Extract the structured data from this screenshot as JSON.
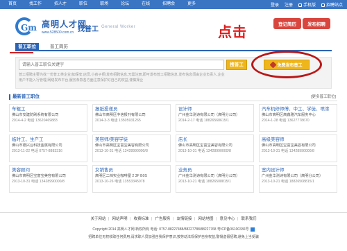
{
  "topnav": {
    "items": [
      "首页",
      "找工作",
      "招人才",
      "职位",
      "职场",
      "论坛",
      "在线",
      "招聘会",
      "更多"
    ],
    "login": "登录",
    "register": "注册",
    "mobile": "手机版",
    "site": "招聘站点"
  },
  "logo": {
    "name": "高明人才网",
    "url": "www.528500.com.cn"
  },
  "subbrand": {
    "cn": "找普工",
    "en": "General Worker"
  },
  "annotation": "点击",
  "buttons": {
    "login": "登记简历",
    "post": "发布招聘"
  },
  "tabs": [
    {
      "label": "普工职位"
    },
    {
      "label": "普工简历"
    }
  ],
  "search": {
    "placeholder": "请输入普工职位关键字",
    "button": "搜普工",
    "post_free": "免费发布普工",
    "tip": "普工招聘主要为找一份普工类企业(如保安,店员,小孩子师)发布招聘信息,无需注册,即可发布普工招聘信息 发布信息须由企业负责人,企业用户不能入行管理,网络发布平台,服务条款各方面注意保护好自己的权益,谨慎择业"
  },
  "latest": {
    "title": "最新普工职位",
    "more": "[更多普工职位]"
  },
  "cards": [
    {
      "title": "车辊工",
      "company": "佛山市安建防刷系统有限公司",
      "meta": "2014-4-2  电话 13620469883"
    },
    {
      "title": "报纸投递员",
      "company": "佛山市高明区中信报刊有限公司",
      "meta": "2014-3-3  电话 13505931265"
    },
    {
      "title": "设计师",
      "company": "广州金华测诗有限公司（高明分公司）",
      "meta": "2014-2-17  电话 18826568615/1"
    },
    {
      "title": "汽车机修师傅、中工、学徒、喷漆",
      "company": "佛山市高明区高鑫雅汽车服务中心",
      "meta": "2014-1-28  电话 13627778670"
    },
    {
      "title": "临时工、生产工",
      "company": "佛山市德兴台科技金属有限公司",
      "meta": "2013-11-22  电话 0757-8883316"
    },
    {
      "title": "美容师/美容学徒",
      "company": "佛山市高明区宝富宝美容有限公司",
      "meta": "2013-10-31  电话 13428990000/8"
    },
    {
      "title": "店长",
      "company": "佛山市高明区宝富宝美容有限公司",
      "meta": "2013-10-31  电话 13428990000/8"
    },
    {
      "title": "高级美容师",
      "company": "佛山市高明区宝富宝美容有限公司",
      "meta": "2013-10-31  电话 13428990000/8"
    },
    {
      "title": "美容顾问",
      "company": "佛山市高明区宝富宝美容有限公司",
      "meta": "2013-10-31  电话 13428990000/8"
    },
    {
      "title": "女销售员",
      "company": "高明区二档实业咖啡屋 2 3F B0S",
      "meta": "2013-10-26  电话 13553345078"
    },
    {
      "title": "业务员",
      "company": "广州金华测诗有限公司（高明分公司）",
      "meta": "2013-10-21  电话 18826508815/1"
    },
    {
      "title": "室内设计师",
      "company": "广州金华测诗有限公司（高明分公司）",
      "meta": "2013-10-21  电话 18826508815/1"
    }
  ],
  "footer": {
    "links": [
      "关于网站",
      "网站声明",
      "收费标准",
      "广告服务",
      "友情链接",
      "网站地图",
      "意见中心",
      "联系我们"
    ],
    "copyright": "Copyright 2014 高明人才网 新权所有 电话: 0757-88227488/88227788/88227768 粤ICP备06100336号",
    "note": "招聘单位无权收取任何费用,请求职人员加强自我保护意识,按劳动法规保护自身权益,警惕虚假招聘,避免上当受骗"
  }
}
